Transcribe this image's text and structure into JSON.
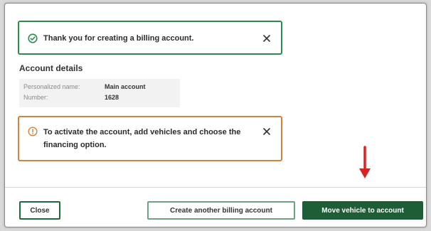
{
  "success_alert": {
    "message": "Thank you for creating a billing account."
  },
  "section_title": "Account details",
  "details": [
    {
      "label": "Personalized name:",
      "value": "Main account"
    },
    {
      "label": "Number:",
      "value": "1628"
    }
  ],
  "warning_alert": {
    "message": "To activate the account, add vehicles and choose the financing option."
  },
  "footer": {
    "close_label": "Close",
    "create_label": "Create another billing account",
    "move_label": "Move vehicle to account"
  },
  "colors": {
    "success": "#2e8b4e",
    "warning": "#d4823c",
    "primary": "#1e5e36",
    "annotation_arrow": "#e02020"
  },
  "icons": {
    "success": "check-circle-icon",
    "warning": "info-circle-icon",
    "close": "close-icon",
    "annotation": "arrow-down-icon"
  }
}
